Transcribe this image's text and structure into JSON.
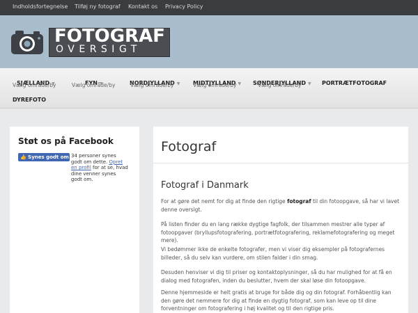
{
  "topnav": {
    "links": [
      "Indholdsfortegnelse",
      "Tilføj ny fotograf",
      "Kontakt os",
      "Privacy Policy"
    ]
  },
  "logo": {
    "line1": "FOTOGRAF",
    "line2": "OVERSIGT"
  },
  "nav": {
    "items": [
      {
        "label": "SJÆLLAND",
        "sub": "Vælg område/by"
      },
      {
        "label": "FYN",
        "sub": "Vælg område/by"
      },
      {
        "label": "NORDJYLLAND",
        "sub": "Vælg område/by"
      },
      {
        "label": "MIDTJYLLAND",
        "sub": "Vælg område/by"
      },
      {
        "label": "SØNDERJYLLAND",
        "sub": "Vælg område/by"
      },
      {
        "label": "PORTRÆTFOTOGRAF"
      },
      {
        "label": "DYREFOTO"
      }
    ]
  },
  "sidebar": {
    "title": "Støt os på Facebook",
    "like_button": "Synes godt om",
    "like_text_1": "34 personer synes godt om dette. ",
    "like_link": "Opret en profil",
    "like_text_2": " for at se, hvad dine venner synes godt om."
  },
  "main": {
    "title": "Fotograf",
    "subtitle": "Fotograf i Danmark",
    "p1_before": "For at gøre det nemt for dig at finde den rigtige ",
    "p1_bold": "fotograf",
    "p1_after": " til din fotoopgave, så har vi lavet denne oversigt.",
    "p2": "På listen finder du en lang række dygtige fagfolk, der tilsammen mestrer alle typer af fotoopgaver (bryllupsfotografering, portrætfotografering, reklamefotografering og meget mere).",
    "p3": "Vi bedømmer ikke de enkelte fotografer, men vi viser dig eksempler på fotografernes billeder, så du selv kan vurdere, om stilen falder i din smag.",
    "p4": "Desuden henviser vi dig til priser og kontaktoplysninger, så du har mulighed for at få en dialog med fotografen, inden du beslutter, hvem der skal løse din fotoopgave.",
    "p5": "Denne hjemmeside er helt gratis at bruge for både dig og din fotograf. Forhåbentlig kan den gøre det nemmere for dig at finde en dygtig fotograf, som kan leve op til dine forventninger om fotografering i høj kvalitet og til den rigtige pris."
  }
}
